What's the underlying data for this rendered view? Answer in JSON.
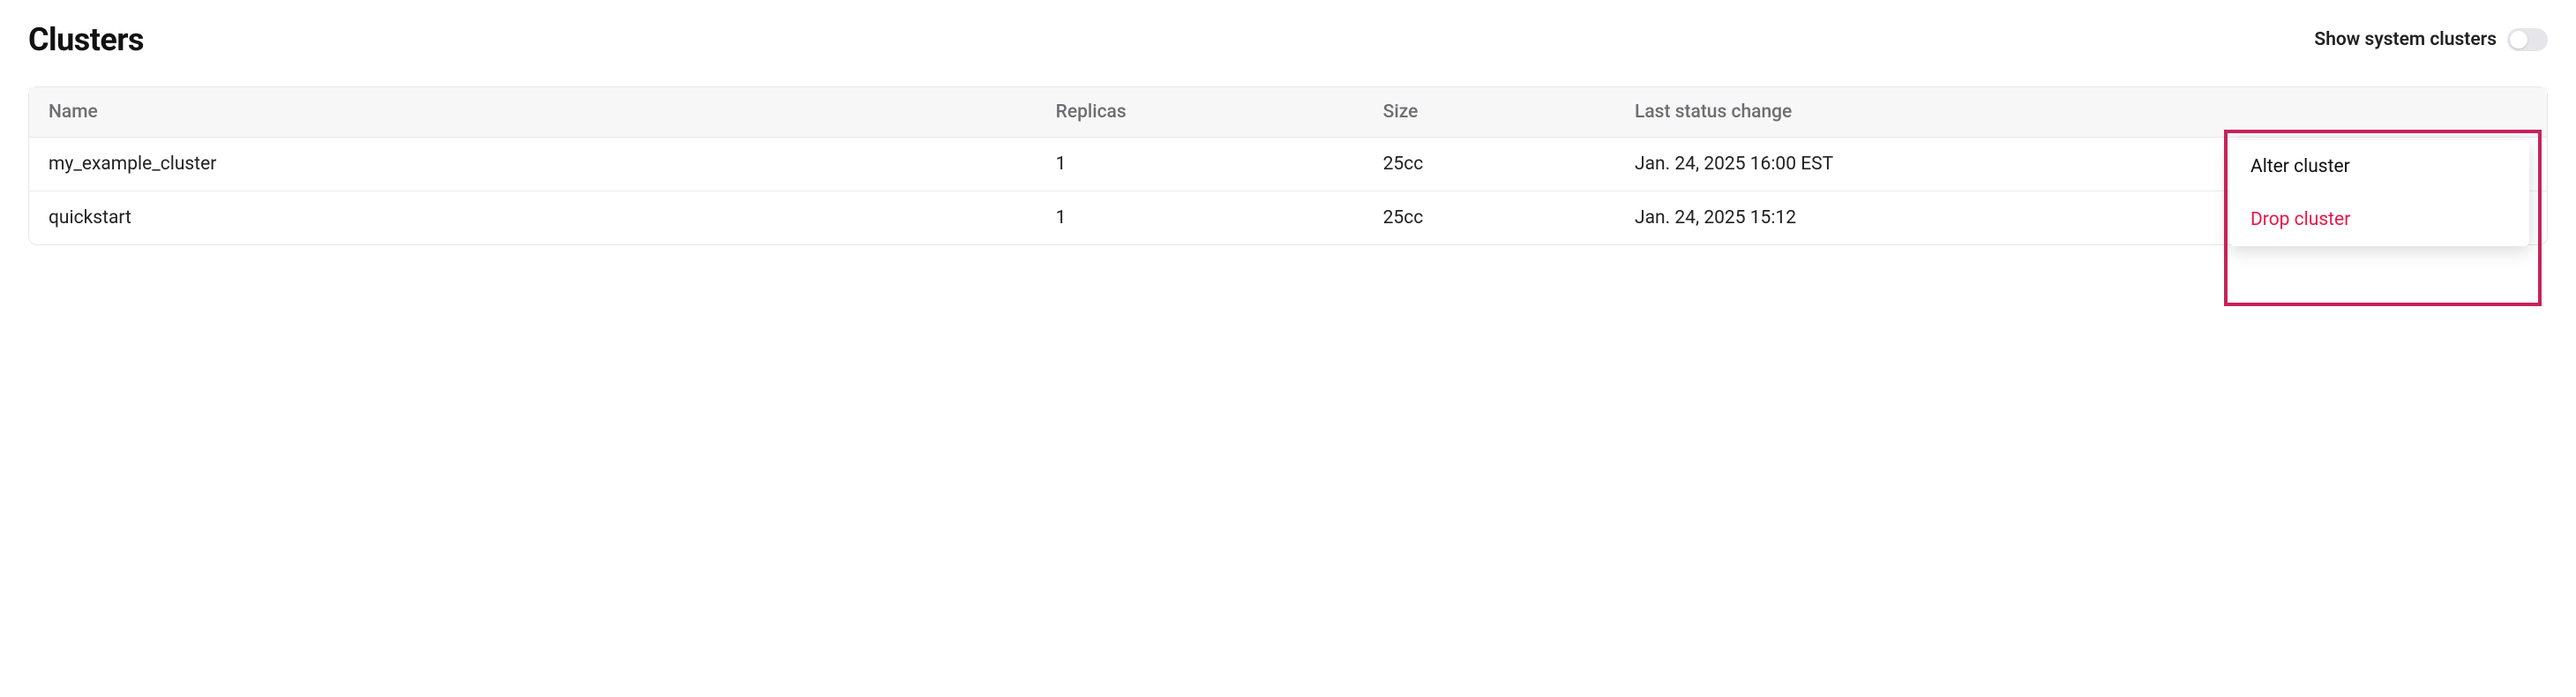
{
  "header": {
    "title": "Clusters",
    "toggle_label": "Show system clusters",
    "toggle_on": false
  },
  "table": {
    "columns": {
      "name": "Name",
      "replicas": "Replicas",
      "size": "Size",
      "last_status_change": "Last status change"
    },
    "rows": [
      {
        "name": "my_example_cluster",
        "replicas": "1",
        "size": "25cc",
        "last_status_change": "Jan. 24, 2025 16:00 EST"
      },
      {
        "name": "quickstart",
        "replicas": "1",
        "size": "25cc",
        "last_status_change": "Jan. 24, 2025 15:12"
      }
    ]
  },
  "row_menu": {
    "alter": "Alter cluster",
    "drop": "Drop cluster"
  },
  "colors": {
    "danger": "#e6174b",
    "highlight_border": "#c5225b"
  }
}
